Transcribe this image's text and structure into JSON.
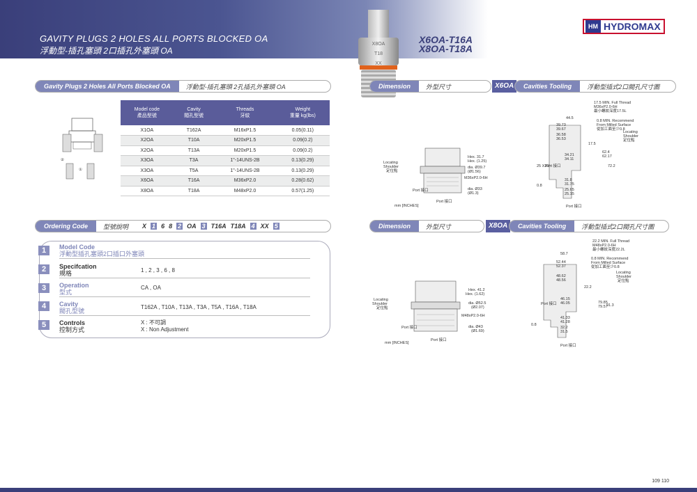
{
  "header": {
    "title": "GAVITY PLUGS 2 HOLES ALL PORTS BLOCKED OA",
    "subtitle": "浮動型-插孔塞頭 2口插孔外塞頭  OA",
    "model_line1": "X6OA-T16A",
    "model_line2": "X8OA-T18A",
    "logo_text": "HYDROMAX",
    "logo_mark": "HM",
    "plug_label": [
      "X8OA",
      "T18",
      "XX"
    ]
  },
  "section1": {
    "label": "Gavity Plugs 2 Holes All Ports Blocked OA",
    "label_cn": "浮動型-插孔塞頭 2孔插孔外塞頭  OA",
    "diagram_ports": [
      "②",
      "①"
    ],
    "table": {
      "headers": [
        [
          "Model code",
          "產品型號"
        ],
        [
          "Cavity",
          "閥孔型號"
        ],
        [
          "Threads",
          "牙紋"
        ],
        [
          "Weight",
          "重量 kg(lbs)"
        ]
      ],
      "rows": [
        [
          "X1OA",
          "T162A",
          "M16xP1.5",
          "0.05(0.11)"
        ],
        [
          "X2OA",
          "T10A",
          "M20xP1.5",
          "0.09(0.2)"
        ],
        [
          "X2OA",
          "T13A",
          "M20xP1.5",
          "0.09(0.2)"
        ],
        [
          "X3OA",
          "T3A",
          "1\"-14UNS-2B",
          "0.13(0.29)"
        ],
        [
          "X3OA",
          "T5A",
          "1\"-14UNS-2B",
          "0.13(0.29)"
        ],
        [
          "X6OA",
          "T16A",
          "M36xP2.0",
          "0.28(0.62)"
        ],
        [
          "X8OA",
          "T18A",
          "M48xP2.0",
          "0.57(1.25)"
        ]
      ]
    }
  },
  "dimension_x6": {
    "label": "Dimension",
    "label_cn": "外型尺寸",
    "tag": "X6OA",
    "cav_label": "Cavities Tooling",
    "cav_cn": "浮動型插式2口閥孔尺寸圖",
    "left_notes": [
      "Locating",
      "Shoulder",
      "定位點"
    ],
    "right_notes": [
      "Hex. 31.7",
      "Hex. (1.25)",
      "dia. Ø39.7",
      "(Ø1.56)",
      "M36xP2.0-6H",
      "dia. Ø33",
      "(Ø1.3)"
    ],
    "port2": "Port 接口",
    "port1": "Port 接口",
    "unit": "mm [INCHES]",
    "cav_notes": [
      "17.5 MIN. Full Thread",
      "M36xP2.0-6H",
      "最小螺紋深度17.5L",
      "44.5",
      "39.73",
      "39.67",
      "36.58",
      "36.53",
      "0.8 MIN. Recommend",
      "From Milled Surface",
      "從加工面至少0.8",
      "Locating",
      "Shoulder",
      "定位點",
      "34.21",
      "34.11",
      "31.8",
      "31.75",
      "25.65",
      "25.15",
      "62.4",
      "62.17",
      "72.2",
      "17.5",
      "0.8",
      "25 X30°"
    ]
  },
  "dimension_x8": {
    "label": "Dimension",
    "label_cn": "外型尺寸",
    "tag": "X8OA",
    "cav_label": "Cavities Tooling",
    "cav_cn": "浮動型插式2口閥孔尺寸圖",
    "left_notes": [
      "Locating",
      "Shoulder",
      "定位點"
    ],
    "right_notes": [
      "Hex. 41.2",
      "Hex. (1.62)",
      "dia. Ø52.5",
      "(Ø2.07)",
      "M48xP2.0-6H",
      "dia. Ø43",
      "(Ø1.69)"
    ],
    "port2": "Port 接口",
    "port1": "Port 接口",
    "unit": "mm [INCHES]",
    "cav_notes": [
      "22.2 MIN. Full Thread",
      "M48xP2.0-6H",
      "最小螺紋深度22.2L",
      "58.7",
      "52.44",
      "52.37",
      "48.62",
      "48.56",
      "0.8 MIN. Recommend",
      "From Milled Surface",
      "從加工面至少0.8",
      "Locating",
      "Shoulder",
      "定位點",
      "46.15",
      "46.05",
      "41.33",
      "41.28",
      "32.2",
      "31.5",
      "79.85",
      "79.57",
      "91.3",
      "22.2",
      "0.8"
    ]
  },
  "ordering": {
    "label": "Ordering Code",
    "label_cn": "型號說明",
    "code_parts": [
      "X",
      "6",
      "8",
      "OA",
      "T16A",
      "T18A",
      "XX"
    ],
    "code_nums": [
      "1",
      "2",
      "3",
      "4",
      "5"
    ],
    "rows": [
      {
        "num": "1",
        "title": "Model Code",
        "title_cn": "浮動型插孔塞頭2口插口外塞頭",
        "value": ""
      },
      {
        "num": "2",
        "title": "Specifcation",
        "title_cn": "規格",
        "value": "1 , 2 , 3 , 6 , 8"
      },
      {
        "num": "3",
        "title": "Operation",
        "title_cn": "型式",
        "value": "CA , OA"
      },
      {
        "num": "4",
        "title": "Cavity",
        "title_cn": "閥孔型號",
        "value": "T162A , T10A , T13A , T3A , T5A , T16A , T18A"
      },
      {
        "num": "5",
        "title": "Controls",
        "title_cn": "控制方式",
        "value": "X : 不可調",
        "value2": "X : Non Adjustment"
      }
    ]
  },
  "page_numbers": "109   110"
}
